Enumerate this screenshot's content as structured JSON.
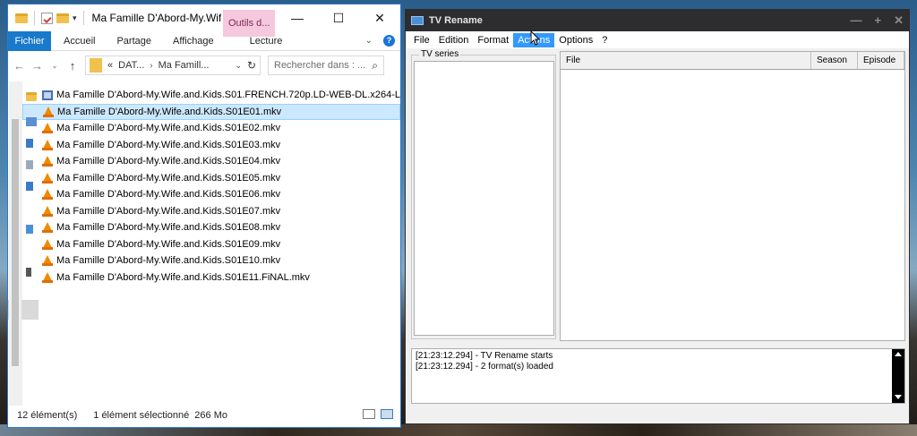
{
  "explorer": {
    "title": "Ma Famille D'Abord-My.Wif...",
    "tools_tab": "Outils d...",
    "ribbon_tabs": [
      "Fichier",
      "Accueil",
      "Partage",
      "Affichage",
      "Lecture"
    ],
    "help": "?",
    "address": {
      "prefix": "«",
      "seg1": "DAT...",
      "seg2": "Ma Famill..."
    },
    "search_placeholder": "Rechercher dans : ...",
    "files": [
      {
        "name": "Ma Famille D'Abord-My.Wife.and.Kids.S01.FRENCH.720p.LD-WEB-DL.x264-L",
        "type": "folder-video",
        "selected": false
      },
      {
        "name": "Ma Famille D'Abord-My.Wife.and.Kids.S01E01.mkv",
        "type": "vlc",
        "selected": true
      },
      {
        "name": "Ma Famille D'Abord-My.Wife.and.Kids.S01E02.mkv",
        "type": "vlc",
        "selected": false
      },
      {
        "name": "Ma Famille D'Abord-My.Wife.and.Kids.S01E03.mkv",
        "type": "vlc",
        "selected": false
      },
      {
        "name": "Ma Famille D'Abord-My.Wife.and.Kids.S01E04.mkv",
        "type": "vlc",
        "selected": false
      },
      {
        "name": "Ma Famille D'Abord-My.Wife.and.Kids.S01E05.mkv",
        "type": "vlc",
        "selected": false
      },
      {
        "name": "Ma Famille D'Abord-My.Wife.and.Kids.S01E06.mkv",
        "type": "vlc",
        "selected": false
      },
      {
        "name": "Ma Famille D'Abord-My.Wife.and.Kids.S01E07.mkv",
        "type": "vlc",
        "selected": false
      },
      {
        "name": "Ma Famille D'Abord-My.Wife.and.Kids.S01E08.mkv",
        "type": "vlc",
        "selected": false
      },
      {
        "name": "Ma Famille D'Abord-My.Wife.and.Kids.S01E09.mkv",
        "type": "vlc",
        "selected": false
      },
      {
        "name": "Ma Famille D'Abord-My.Wife.and.Kids.S01E10.mkv",
        "type": "vlc",
        "selected": false
      },
      {
        "name": "Ma Famille D'Abord-My.Wife.and.Kids.S01E11.FiNAL.mkv",
        "type": "vlc",
        "selected": false
      }
    ],
    "status": {
      "count": "12 élément(s)",
      "selected": "1 élément sélectionné",
      "size": "266 Mo"
    }
  },
  "tvrename": {
    "title": "TV Rename",
    "menu": [
      "File",
      "Edition",
      "Format",
      "Actions",
      "Options",
      "?"
    ],
    "active_menu": "Actions",
    "series_label": "TV series",
    "columns": [
      "File",
      "Season",
      "Episode"
    ],
    "log": [
      "[21:23:12.294] - TV Rename starts",
      "[21:23:12.294] - 2 format(s) loaded"
    ]
  },
  "colors": {
    "accent": "#1979ca",
    "selection": "#cce8ff",
    "menu_highlight": "#3399ff",
    "tools_tab": "#f6c8de",
    "dark_title": "#2d2d30"
  }
}
